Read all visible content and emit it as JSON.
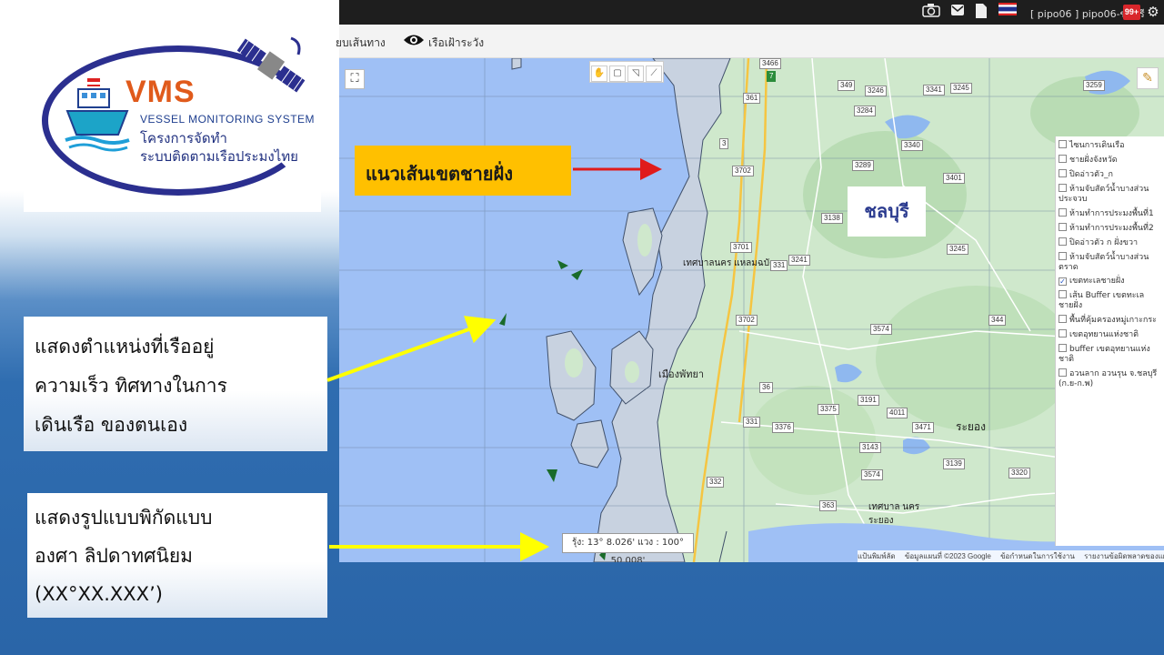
{
  "logo": {
    "title": "VMS",
    "subtitle": "VESSEL MONITORING SYSTEM",
    "line1": "โครงการจัดทำ",
    "line2": "ระบบติดตามเรือประมงไทย"
  },
  "topbar": {
    "user": "[ pipo06 ] pipo06-ชลบุรี",
    "badge": "99+",
    "icons": [
      "camera-icon",
      "mail-icon",
      "document-icon",
      "thai-flag-icon",
      "gear-icon"
    ]
  },
  "toolbar": {
    "route_label": "ยบเส้นทาง",
    "watch_label": "เรือเฝ้าระวัง"
  },
  "map": {
    "coord_readout": "รุ้ง: 13° 8.026' แวง : 100° 50.008'",
    "place_labels": [
      "เทศบาลนคร แหลมฉบัง",
      "เมืองพัทยา",
      "ระยอง",
      "เทศบาล นครระยอง"
    ],
    "road_numbers": [
      "3466",
      "349",
      "3246",
      "3341",
      "3245",
      "3259",
      "361",
      "3284",
      "3340",
      "3702",
      "3289",
      "3401",
      "3138",
      "3701",
      "3241",
      "3245",
      "331",
      "3702",
      "3574",
      "344",
      "36",
      "3191",
      "4011",
      "3375",
      "331",
      "3376",
      "3471",
      "3143",
      "3139",
      "3574",
      "332",
      "3320",
      "363",
      "3",
      "7"
    ],
    "attribution": [
      "แป้นพิมพ์ลัด",
      "ข้อมูลแผนที่ ©2023 Google",
      "ข้อกำหนดในการใช้งาน",
      "รายงานข้อผิดพลาดของแผนที่"
    ],
    "layers": [
      {
        "label": "ไซนการเดินเรือ",
        "checked": false
      },
      {
        "label": "ชายฝั่งจังหวัด",
        "checked": false
      },
      {
        "label": "ปิดอ่าวตัว_ก",
        "checked": false
      },
      {
        "label": "ห้ามจับสัตว์น้ำบางส่วน ประจวบ",
        "checked": false
      },
      {
        "label": "ห้ามทำการประมงพื้นที่1",
        "checked": false
      },
      {
        "label": "ห้ามทำการประมงพื้นที่2",
        "checked": false
      },
      {
        "label": "ปิดอ่าวตัว ก ฝั่งขวา",
        "checked": false
      },
      {
        "label": "ห้ามจับสัตว์น้ำบางส่วน ตราด",
        "checked": false
      },
      {
        "label": "เขตทะเลชายฝั่ง",
        "checked": true
      },
      {
        "label": "เส้น Buffer เขตทะเล ชายฝั่ง",
        "checked": false
      },
      {
        "label": "พื้นที่คุ้มครองหมู่เกาะกระ",
        "checked": false
      },
      {
        "label": "เขตอุทยานแห่งชาติ",
        "checked": false
      },
      {
        "label": "buffer เขตอุทยานแห่ง ชาติ",
        "checked": false
      },
      {
        "label": "อวนลาก อวนรุน จ.ชลบุรี (ก.ย-ก.พ)",
        "checked": false
      }
    ]
  },
  "callouts": {
    "coast": "แนวเส้นเขตชายฝั่ง",
    "province": "ชลบุรี",
    "position_lines": [
      "แสดงตำแหน่งที่เรืออยู่",
      "ความเร็ว ทิศทางในการ",
      "เดินเรือ ของตนเอง"
    ],
    "format_lines": [
      "แสดงรูปแบบพิกัดแบบ",
      "องศา ลิปดาทศนิยม",
      "(XX°XX.XXX’)"
    ]
  },
  "colors": {
    "sea": "#9fc0f5",
    "land": "#cfe8cc",
    "coastal_zone": "#c8d2e0",
    "callout_yellow": "#ffc000",
    "arrow_red": "#e01b1b",
    "arrow_yellow": "#ffff00",
    "bg_blue": "#2f6db0"
  }
}
